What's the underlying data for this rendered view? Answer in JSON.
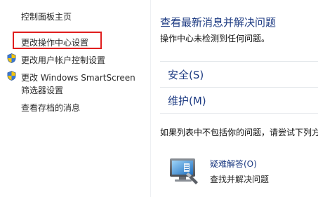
{
  "sidebar": {
    "home_label": "控制面板主页",
    "links": [
      {
        "label": "更改操作中心设置",
        "highlighted": true
      },
      {
        "label": "更改用户帐户控制设置",
        "icon": "uac-shield-icon"
      },
      {
        "label": "更改 Windows SmartScreen",
        "sub": "筛选器设置",
        "icon": "uac-shield-icon"
      },
      {
        "label": "查看存档的消息"
      }
    ]
  },
  "main": {
    "title": "查看最新消息并解决问题",
    "status": "操作中心未检测到任何问题。",
    "sections": [
      {
        "label": "安全(S)"
      },
      {
        "label": "维护(M)"
      }
    ],
    "info": "如果列表中不包括你的问题，请尝试下列方",
    "troubleshoot": {
      "link": "疑难解答(O)",
      "desc": "查找并解决问题",
      "icon": "troubleshooting-computer-icon"
    }
  },
  "colors": {
    "link_blue": "#1c3a82",
    "highlight_red": "#e01e1e",
    "divider": "#eef0f3"
  }
}
